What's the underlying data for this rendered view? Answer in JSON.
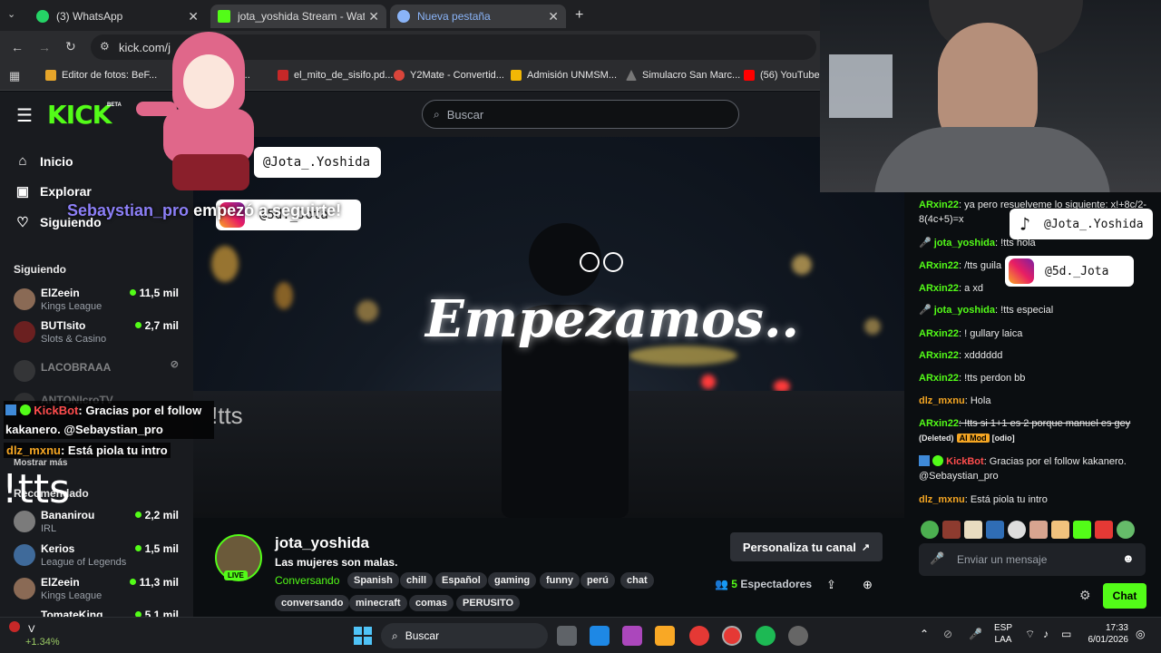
{
  "browser": {
    "tabs": [
      {
        "label": "(3) WhatsApp",
        "icon": "whatsapp-icon",
        "color": "#25d366"
      },
      {
        "label": "jota_yoshida Stream - Watch Li",
        "icon": "kick-icon",
        "color": "#53fc18"
      },
      {
        "label": "Nueva pestaña",
        "icon": "chrome-icon",
        "color": "#8ab4f8"
      }
    ],
    "url": "kick.com/j",
    "bookmarks": [
      {
        "label": "Editor de fotos: BeF...",
        "color": "#e6a52a"
      },
      {
        "label": "ye...",
        "color": "#d36b1f"
      },
      {
        "label": "el_mito_de_sisifo.pd...",
        "color": "#c62828"
      },
      {
        "label": "Y2Mate - Convertid...",
        "color": "#d9453b"
      },
      {
        "label": "Admisión UNMSM...",
        "color": "#f2b705"
      },
      {
        "label": "Simulacro San Marc...",
        "color": "#555555"
      },
      {
        "label": "(56) YouTube",
        "color": "#ff0000"
      }
    ]
  },
  "header": {
    "logo": "KICK",
    "logo_beta": "BETA",
    "search_placeholder": "Buscar"
  },
  "sidebar": {
    "nav": [
      {
        "label": "Inicio",
        "icon": "home-icon"
      },
      {
        "label": "Explorar",
        "icon": "browse-icon"
      },
      {
        "label": "Siguiendo",
        "icon": "heart-icon"
      }
    ],
    "following_title": "Siguiendo",
    "following": [
      {
        "name": "ElZeein",
        "category": "Kings League",
        "viewers": "11,5 mil"
      },
      {
        "name": "BUTIsito",
        "category": "Slots & Casino",
        "viewers": "2,7 mil"
      },
      {
        "name": "LACOBRAAA",
        "category": "",
        "viewers": ""
      },
      {
        "name": "ANTONIcroTV",
        "category": "",
        "viewers": ""
      }
    ],
    "show_more": "Mostrar más",
    "recommended_title": "Recomendado",
    "recommended": [
      {
        "name": "Bananirou",
        "category": "IRL",
        "viewers": "2,2 mil"
      },
      {
        "name": "Kerios",
        "category": "League of Legends",
        "viewers": "1,5 mil"
      },
      {
        "name": "ElZeein",
        "category": "Kings League",
        "viewers": "11,3 mil"
      },
      {
        "name": "TomateKing",
        "category": "",
        "viewers": "5,1 mil"
      }
    ]
  },
  "overlay": {
    "handle_1": "@Jota_.Yoshida",
    "handle_2": "@5d._Jota",
    "follow_alert_user": "Sebaystian_pro",
    "follow_alert_text": "empezó a seguirte!",
    "kickbot_name": "KickBot",
    "kickbot_text": ": Gracias por el follow kakanero. @Sebaystian_pro",
    "dlz_name": "dlz_mxnu",
    "dlz_text": ": Está piola tu intro",
    "tts_small": "!tts",
    "tts_big": "!tts",
    "stream_title_art": "Empezamos..",
    "webcam_handle_tiktok": "@Jota_.Yoshida",
    "webcam_handle_instagram": "@5d._Jota"
  },
  "stream": {
    "channel": "jota_yoshida",
    "live_badge": "LIVE",
    "title": "Las mujeres son malas.",
    "category": "Conversando",
    "tags": [
      "Spanish",
      "chill",
      "Español",
      "gaming",
      "funny",
      "perú",
      "chat",
      "conversando",
      "minecraft",
      "comas",
      "PERUSITO"
    ],
    "customize_button": "Personaliza tu canal",
    "viewers": "5",
    "viewers_label": "Espectadores"
  },
  "chat": {
    "messages": [
      {
        "user": "ARxin22",
        "color": "#53fc18",
        "text": ": ya pero resuelveme lo siguiente: x!+8c/2-8(4c+5)=x"
      },
      {
        "user": "jota_yoshida",
        "color": "#53fc18",
        "text": ": !tts hola"
      },
      {
        "user": "ARxin22",
        "color": "#53fc18",
        "text": ": /tts guila"
      },
      {
        "user": "ARxin22",
        "color": "#53fc18",
        "text": ": a xd"
      },
      {
        "user": "jota_yoshida",
        "color": "#53fc18",
        "text": ": !tts especial"
      },
      {
        "user": "ARxin22",
        "color": "#53fc18",
        "text": ": ! gullary laica"
      },
      {
        "user": "ARxin22",
        "color": "#53fc18",
        "text": ": xdddddd"
      },
      {
        "user": "ARxin22",
        "color": "#53fc18",
        "text": ": !tts perdon bb"
      },
      {
        "user": "dlz_mxnu",
        "color": "#f5a623",
        "text": ": Hola"
      },
      {
        "user": "ARxin22",
        "color": "#53fc18",
        "text": ": !tts si 1+1 es 2 porque manuel es gey"
      },
      {
        "user": "KickBot",
        "color": "#ff4d4d",
        "text": ": Gracias por el follow kakanero. @Sebaystian_pro"
      },
      {
        "user": "dlz_mxnu",
        "color": "#f5a623",
        "text": ": Está piola tu intro"
      }
    ],
    "deleted_label": "(Deleted)",
    "ai_mod_label": "AI Mod",
    "odio_label": "[odio]",
    "input_placeholder": "Enviar un mensaje",
    "send_button": "Chat"
  },
  "taskbar": {
    "stock_symbol": "V",
    "stock_change": "+1.34%",
    "search_label": "Buscar",
    "lang": "ESP",
    "lang2": "LAA",
    "time": "17:33",
    "date": "6/01/2026"
  }
}
